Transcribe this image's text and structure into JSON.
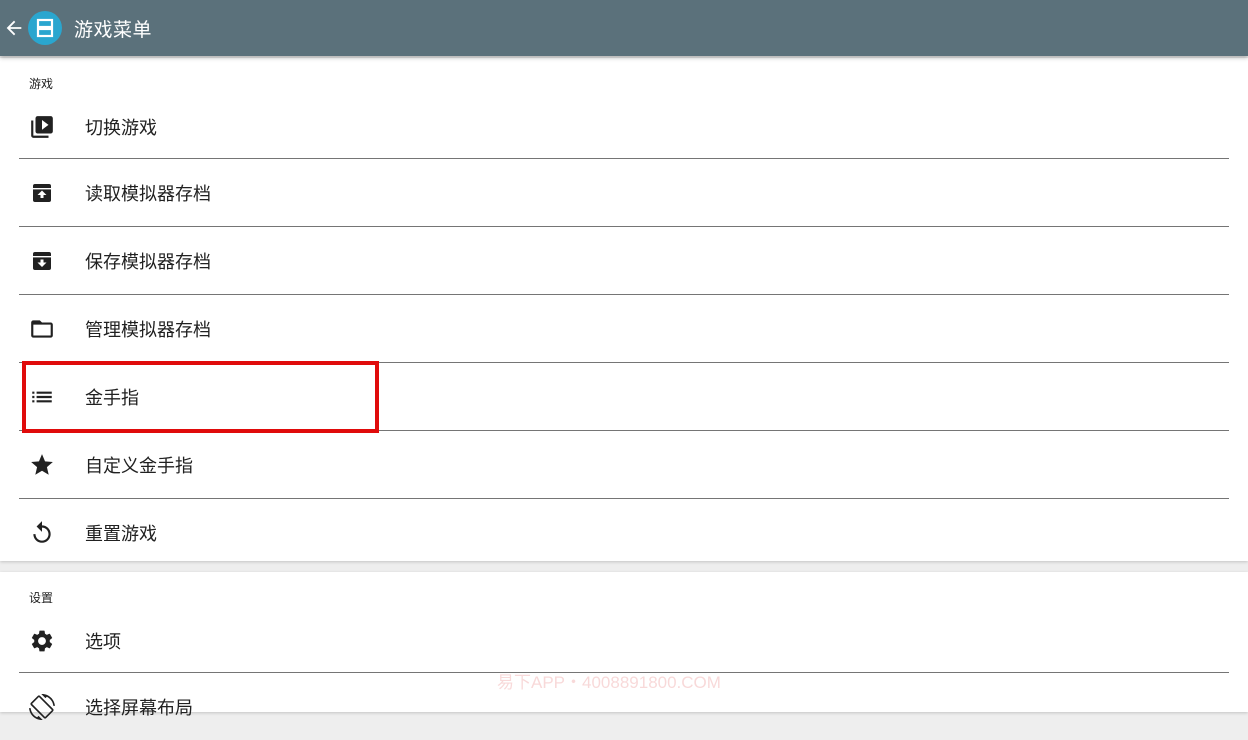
{
  "appbar": {
    "title": "游戏菜单",
    "back_icon": "arrow-left-icon",
    "logo_icon": "app-logo-icon",
    "background": "#5b717b",
    "logo_color": "#2aa6cf"
  },
  "game_section": {
    "header": "游戏",
    "items": [
      {
        "label": "切换游戏",
        "icon": "video-library-icon"
      },
      {
        "label": "读取模拟器存档",
        "icon": "archive-upload-icon"
      },
      {
        "label": "保存模拟器存档",
        "icon": "archive-download-icon"
      },
      {
        "label": "管理模拟器存档",
        "icon": "folder-icon"
      },
      {
        "label": "金手指",
        "icon": "list-icon"
      },
      {
        "label": "自定义金手指",
        "icon": "star-icon"
      },
      {
        "label": "重置游戏",
        "icon": "reset-icon"
      }
    ]
  },
  "settings_section": {
    "header": "设置",
    "items": [
      {
        "label": "选项",
        "icon": "gear-icon"
      },
      {
        "label": "选择屏幕布局",
        "icon": "screen-rotation-icon"
      }
    ]
  },
  "highlight_color": "#e00b0b",
  "watermark": "易下APP・4008891800.COM"
}
